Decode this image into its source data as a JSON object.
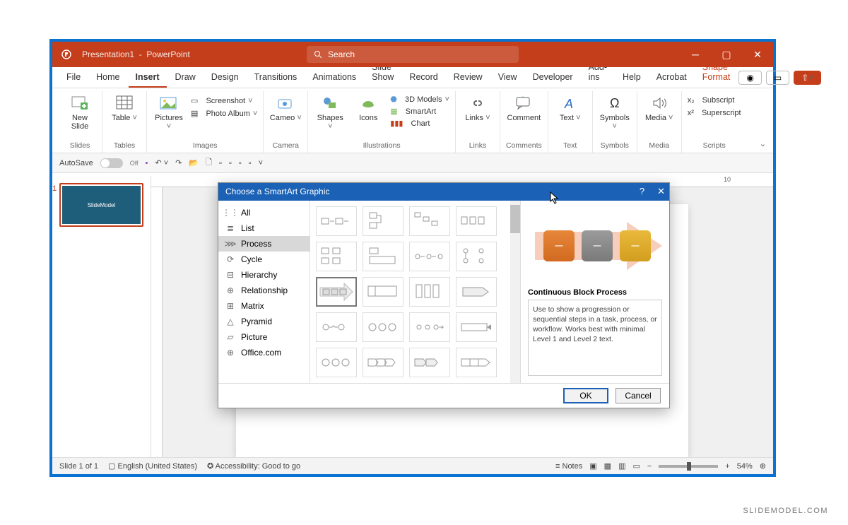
{
  "title": {
    "document": "Presentation1",
    "appname": "PowerPoint"
  },
  "search": {
    "placeholder": "Search"
  },
  "tabs": [
    "File",
    "Home",
    "Insert",
    "Draw",
    "Design",
    "Transitions",
    "Animations",
    "Slide Show",
    "Record",
    "Review",
    "View",
    "Developer",
    "Add-ins",
    "Help",
    "Acrobat",
    "Shape Format"
  ],
  "ribbon": {
    "slides": {
      "caption": "Slides",
      "new_slide": "New\nSlide"
    },
    "tables": {
      "caption": "Tables",
      "table": "Table"
    },
    "images": {
      "caption": "Images",
      "pictures": "Pictures",
      "screenshot": "Screenshot",
      "photo_album": "Photo Album"
    },
    "camera": {
      "caption": "Camera",
      "cameo": "Cameo"
    },
    "illustrations": {
      "caption": "Illustrations",
      "shapes": "Shapes",
      "icons": "Icons",
      "models": "3D Models",
      "smartart": "SmartArt",
      "chart": "Chart"
    },
    "links": {
      "caption": "Links",
      "links": "Links"
    },
    "comments": {
      "caption": "Comments",
      "comment": "Comment"
    },
    "text": {
      "caption": "Text",
      "text": "Text"
    },
    "symbols": {
      "caption": "Symbols",
      "symbols": "Symbols"
    },
    "media": {
      "caption": "Media",
      "media": "Media"
    },
    "scripts": {
      "caption": "Scripts",
      "subscript": "Subscript",
      "superscript": "Superscript"
    }
  },
  "qat": {
    "autosave": "AutoSave",
    "off": "Off"
  },
  "ruler_value": "10",
  "thumb_num": "1",
  "thumb_label": "SlideModel",
  "dialog": {
    "title": "Choose a SmartArt Graphic",
    "categories": [
      "All",
      "List",
      "Process",
      "Cycle",
      "Hierarchy",
      "Relationship",
      "Matrix",
      "Pyramid",
      "Picture",
      "Office.com"
    ],
    "selected_category": "Process",
    "preview_title": "Continuous Block Process",
    "preview_desc": "Use to show a progression or sequential steps in a task, process, or workflow. Works best with minimal Level 1 and Level 2 text.",
    "ok": "OK",
    "cancel": "Cancel",
    "help": "?",
    "close": "✕"
  },
  "status": {
    "slide": "Slide 1 of 1",
    "lang": "English (United States)",
    "access": "Accessibility: Good to go",
    "notes": "Notes",
    "zoom": "54%"
  },
  "watermark": "SLIDEMODEL.COM"
}
